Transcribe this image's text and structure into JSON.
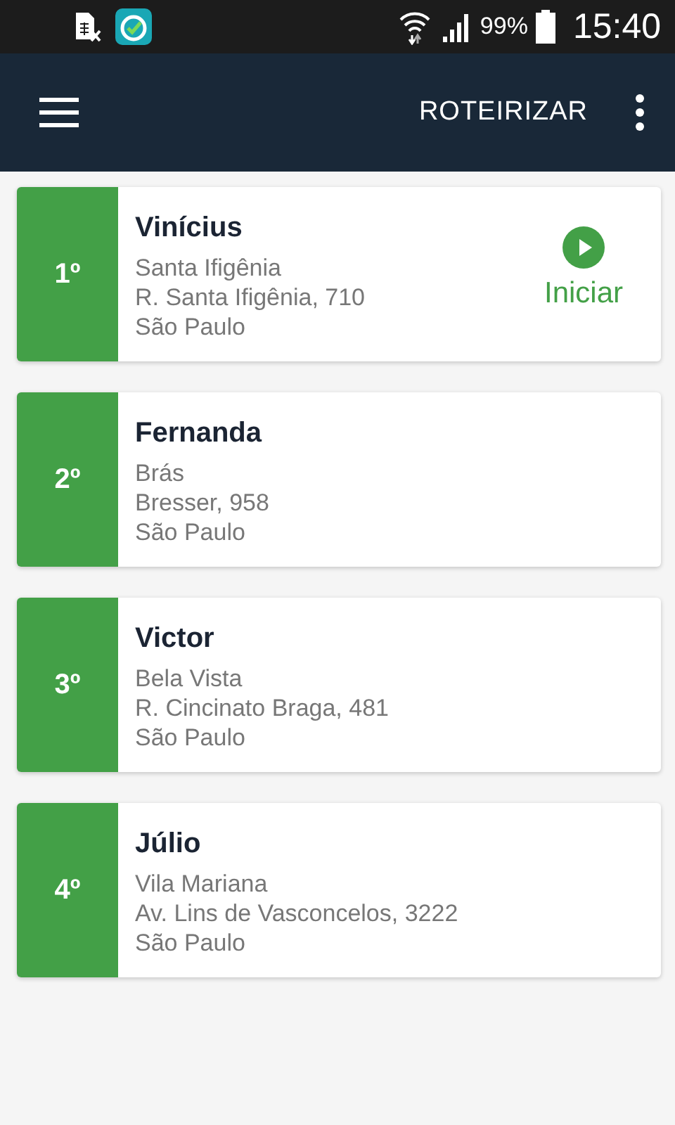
{
  "status_bar": {
    "battery": "99%",
    "time": "15:40"
  },
  "app_bar": {
    "action": "ROTEIRIZAR"
  },
  "stops": [
    {
      "order": "1º",
      "name": "Vinícius",
      "district": "Santa Ifigênia",
      "address": "R. Santa Ifigênia, 710",
      "city": "São Paulo",
      "action": "Iniciar"
    },
    {
      "order": "2º",
      "name": "Fernanda",
      "district": "Brás",
      "address": "Bresser, 958",
      "city": "São Paulo"
    },
    {
      "order": "3º",
      "name": "Victor",
      "district": "Bela Vista",
      "address": "R. Cincinato Braga, 481",
      "city": "São Paulo"
    },
    {
      "order": "4º",
      "name": "Júlio",
      "district": "Vila Mariana",
      "address": "Av. Lins de Vasconcelos, 3222",
      "city": "São Paulo"
    }
  ]
}
